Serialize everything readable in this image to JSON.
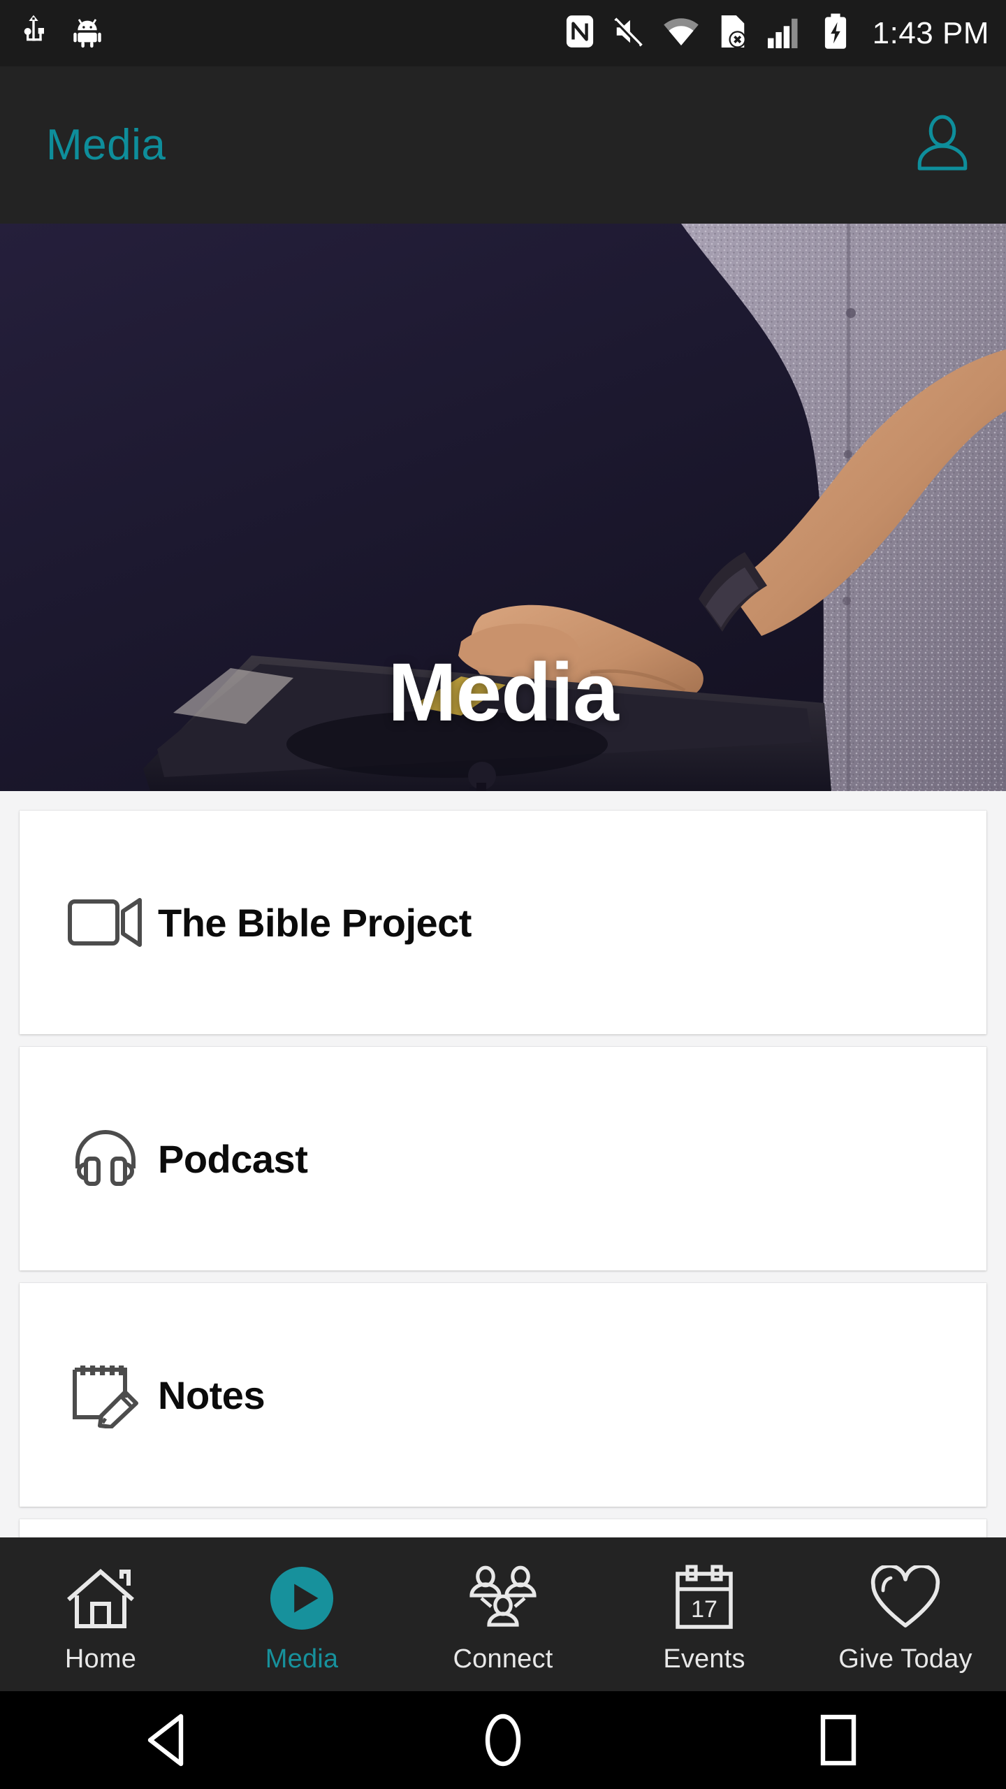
{
  "status_bar": {
    "time": "1:43 PM",
    "left_icons": [
      "usb-icon",
      "android-debug-icon"
    ],
    "right_icons": [
      "nfc-icon",
      "volume-mute-icon",
      "wifi-icon",
      "sim-card-error-icon",
      "cellular-signal-icon",
      "battery-charging-icon"
    ]
  },
  "app_bar": {
    "title": "Media",
    "profile_icon": "person-icon",
    "title_color": "#0e8e9b",
    "background_color": "#232323"
  },
  "hero": {
    "overlay_title": "Media",
    "description": "photo of a speaker at a podium gesturing with hands",
    "background_color": "#1d1930"
  },
  "media_list": [
    {
      "label": "The Bible Project",
      "icon": "video-camera-icon"
    },
    {
      "label": "Podcast",
      "icon": "headphones-icon"
    },
    {
      "label": "Notes",
      "icon": "notepad-pencil-icon"
    },
    {
      "label": "",
      "icon": ""
    }
  ],
  "tab_bar": {
    "accent_color": "#17919c",
    "items": [
      {
        "label": "Home",
        "icon": "house-icon",
        "active": false
      },
      {
        "label": "Media",
        "icon": "play-circle-icon",
        "active": true
      },
      {
        "label": "Connect",
        "icon": "people-group-icon",
        "active": false
      },
      {
        "label": "Events",
        "icon": "calendar-icon",
        "active": false,
        "calendar_day": "17"
      },
      {
        "label": "Give Today",
        "icon": "heart-icon",
        "active": false
      }
    ]
  },
  "android_nav": {
    "back": "back-triangle-icon",
    "home": "home-circle-icon",
    "recents": "recents-square-icon"
  }
}
